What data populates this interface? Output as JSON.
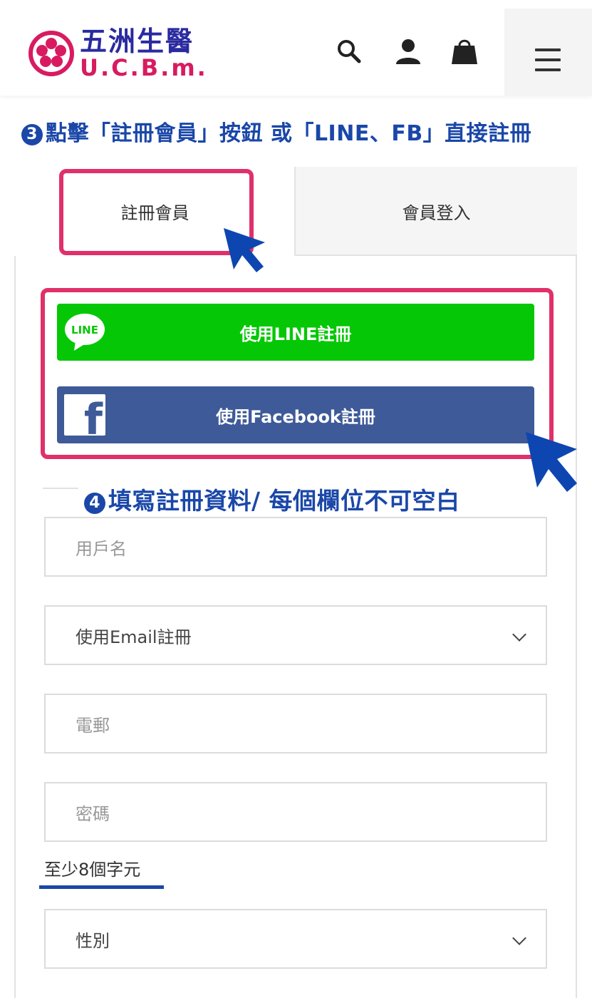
{
  "header": {
    "logo_cn": "五洲生醫",
    "logo_en": "U.C.B.m.",
    "icons": [
      "search-icon",
      "user-icon",
      "shopping-bag-icon",
      "hamburger-menu-icon"
    ]
  },
  "annotations": {
    "step3_num": "3",
    "step3_text": "點擊「註冊會員」按鈕 或「LINE、FB」直接註冊",
    "step4_num": "4",
    "step4_text": "填寫註冊資料/ 每個欄位不可空白"
  },
  "tabs": {
    "register": "註冊會員",
    "login": "會員登入"
  },
  "social": {
    "line_badge": "LINE",
    "line_label": "使用LINE註冊",
    "facebook_label": "使用Facebook註冊"
  },
  "form": {
    "username_placeholder": "用戶名",
    "register_method_value": "使用Email註冊",
    "email_placeholder": "電郵",
    "password_placeholder": "密碼",
    "password_hint": "至少8個字元",
    "gender_value": "性別"
  },
  "colors": {
    "highlight": "#e0306a",
    "annotation_blue": "#1a47a8",
    "line_green": "#06c706",
    "facebook_blue": "#3e5a98",
    "logo_pink": "#d81b60",
    "logo_navy": "#2a2aa0"
  }
}
